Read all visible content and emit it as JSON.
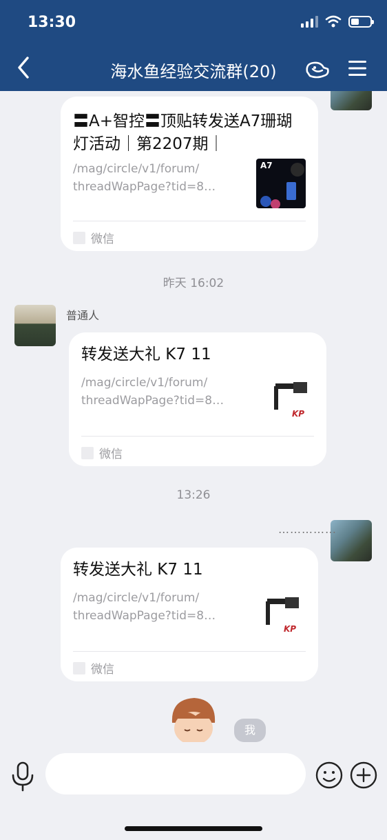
{
  "status_bar": {
    "time": "13:30"
  },
  "header": {
    "title": "海水鱼经验交流群(20)",
    "back_icon": "chevron-left-icon",
    "extra_icon": "group-people-icon",
    "menu_icon": "hamburger-menu-icon"
  },
  "messages": [
    {
      "title": "〓A+智控〓顶贴转发送A7珊瑚灯活动｜第2207期｜",
      "desc_line1": "/mag/circle/v1/forum/",
      "desc_line2": "threadWapPage?tid=8…",
      "thumb_text": "A7",
      "source": "微信"
    },
    {
      "time_label": "昨天 16:02"
    },
    {
      "sender": "普通人",
      "title": "转发送大礼 K7 11",
      "desc_line1": "/mag/circle/v1/forum/",
      "desc_line2": "threadWapPage?tid=8…",
      "thumb_text": "KP",
      "source": "微信"
    },
    {
      "time_label": "13:26"
    },
    {
      "sender": "……………",
      "title": "转发送大礼 K7 11",
      "desc_line1": "/mag/circle/v1/forum/",
      "desc_line2": "threadWapPage?tid=8…",
      "thumb_text": "KP",
      "source": "微信"
    },
    {
      "badge": "我"
    }
  ],
  "input_bar": {
    "placeholder": "",
    "mic_icon": "microphone-icon",
    "emoji_icon": "smiley-icon",
    "plus_icon": "plus-circle-icon"
  },
  "colors": {
    "header_bg": "#1f4a82",
    "chat_bg": "#eff0f4",
    "card_bg": "#ffffff"
  }
}
